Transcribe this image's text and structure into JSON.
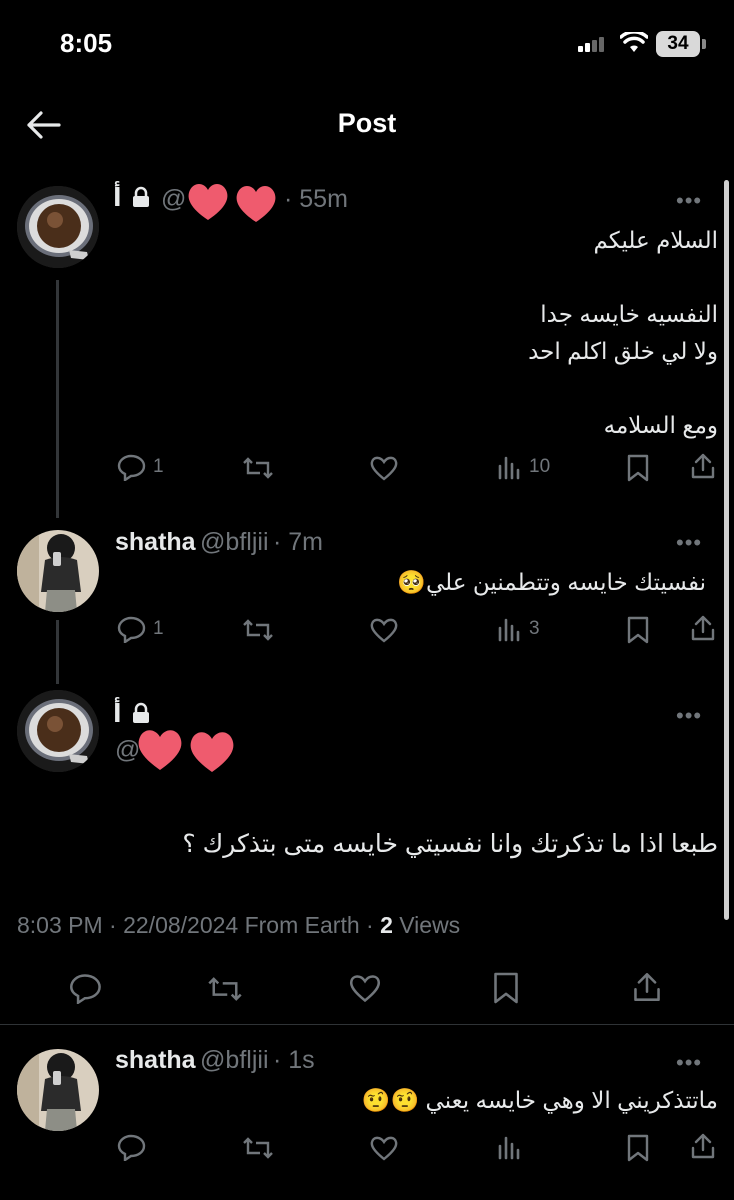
{
  "status_bar": {
    "time": "8:05",
    "battery": "34"
  },
  "header": {
    "title": "Post"
  },
  "posts": [
    {
      "name": "أ",
      "handle_prefix": "@",
      "time": "· 55m",
      "lines": [
        "السلام عليكم",
        "",
        "النفسيه خايسه جدا",
        "ولا لي خلق اكلم احد",
        "",
        "ومع السلامه"
      ],
      "replies": "1",
      "views": "10"
    },
    {
      "name": "shatha",
      "handle": "@bfljii",
      "time": "· 7m",
      "lines": [
        "نفسيتك خايسه وتتطمنين علي🥺"
      ],
      "replies": "1",
      "views": "3"
    },
    {
      "name": "أ",
      "handle_prefix": "@",
      "lines": [
        "طبعا اذا ما تذكرتك وانا نفسيتي خايسه متى بتذكرك ؟"
      ],
      "meta_time": "8:03 PM · 22/08/2024 From Earth · ",
      "meta_views_count": "2",
      "meta_views_label": " Views"
    },
    {
      "name": "shatha",
      "handle": "@bfljii",
      "time": "· 1s",
      "lines": [
        "ماتتذكريني الا وهي خايسه يعني 🤨🤨"
      ]
    }
  ],
  "colors": {
    "background": "#000000",
    "text": "#e7e9ea",
    "muted": "#71767b",
    "heart_sticker": "#ef5b6e"
  }
}
